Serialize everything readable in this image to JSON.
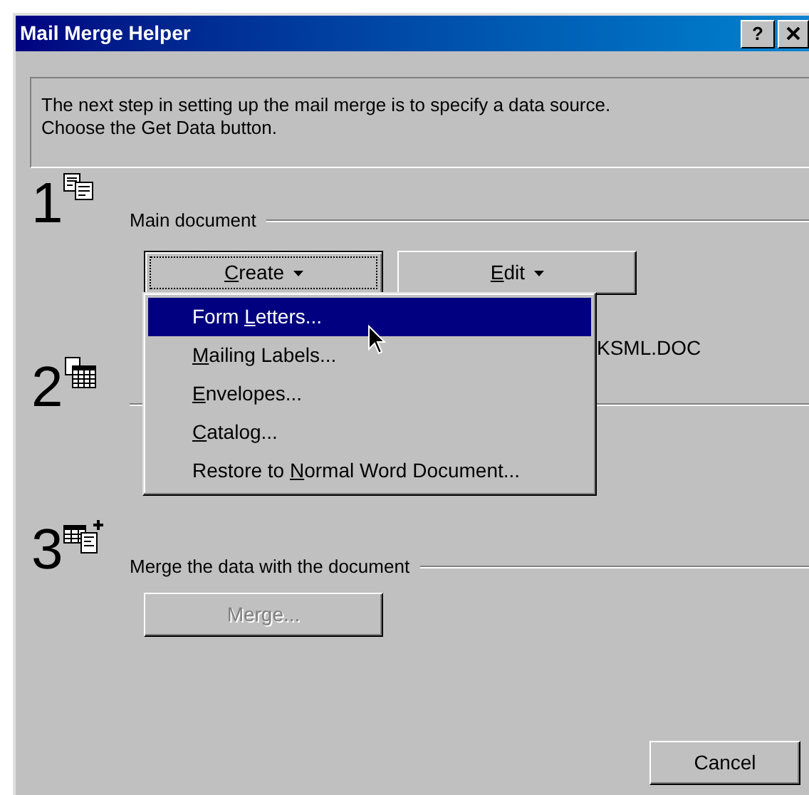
{
  "window": {
    "title": "Mail Merge Helper",
    "help_button": "?"
  },
  "instructions": "The next step in setting up the mail merge is to specify a data source.\nChoose the Get Data button.",
  "steps": [
    {
      "number": "1",
      "kind": "main_document",
      "label": "Main document",
      "buttons": [
        {
          "key": "C",
          "post": "reate",
          "caret": true,
          "focused": true,
          "disabled": false
        },
        {
          "key": "E",
          "post": "dit",
          "caret": true,
          "focused": false,
          "disabled": false
        }
      ],
      "file": "KSML.DOC"
    },
    {
      "number": "2",
      "kind": "data_source"
    },
    {
      "number": "3",
      "kind": "merge",
      "label": "Merge the data with the document",
      "buttons": [
        {
          "pre": "Merge...",
          "caret": false,
          "focused": false,
          "disabled": true
        }
      ]
    }
  ],
  "menu": {
    "items": [
      {
        "pre": "Form ",
        "key": "L",
        "post": "etters...",
        "selected": true
      },
      {
        "key": "M",
        "post": "ailing Labels...",
        "selected": false
      },
      {
        "key": "E",
        "post": "nvelopes...",
        "selected": false
      },
      {
        "key": "C",
        "post": "atalog...",
        "selected": false
      },
      {
        "pre": "Restore to ",
        "key": "N",
        "post": "ormal Word Document...",
        "selected": false
      }
    ]
  },
  "cancel_button": "Cancel"
}
